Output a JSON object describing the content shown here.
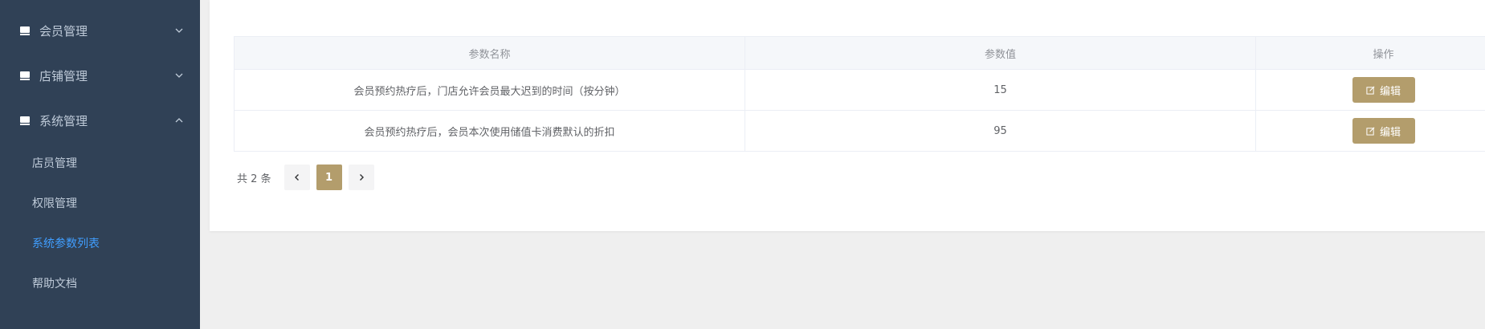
{
  "sidebar": {
    "menus": [
      {
        "label": "会员管理",
        "icon": "store-icon",
        "expanded": false
      },
      {
        "label": "店铺管理",
        "icon": "store-icon",
        "expanded": false
      },
      {
        "label": "系统管理",
        "icon": "store-icon",
        "expanded": true
      }
    ],
    "submenu": [
      {
        "label": "店员管理",
        "active": false
      },
      {
        "label": "权限管理",
        "active": false
      },
      {
        "label": "系统参数列表",
        "active": true
      },
      {
        "label": "帮助文档",
        "active": false
      }
    ]
  },
  "table": {
    "headers": [
      "参数名称",
      "参数值",
      "操作"
    ],
    "rows": [
      {
        "name": "会员预约热疗后，门店允许会员最大迟到的时间（按分钟）",
        "value": "15",
        "action": "编辑"
      },
      {
        "name": "会员预约热疗后，会员本次使用储值卡消费默认的折扣",
        "value": "95",
        "action": "编辑"
      }
    ]
  },
  "pagination": {
    "total": "共 2 条",
    "current_page": "1"
  },
  "colors": {
    "sidebar_bg": "#304156",
    "sidebar_text": "#bfcbd9",
    "active_text": "#409eff",
    "accent": "#b39d6c"
  }
}
